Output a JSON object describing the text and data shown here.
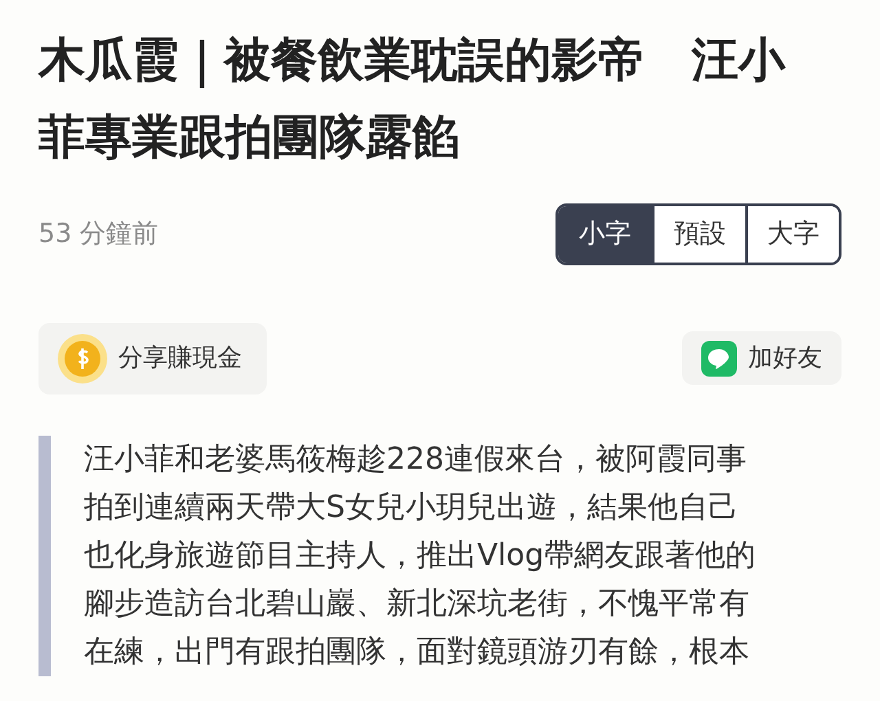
{
  "title": "木瓜霞｜被餐飲業耽誤的影帝　汪小菲專業跟拍團隊露餡",
  "time": "53 分鐘前",
  "font_sizes": [
    {
      "label": "小字",
      "selected": true
    },
    {
      "label": "預設",
      "selected": false
    },
    {
      "label": "大字",
      "selected": false
    }
  ],
  "share_button": "分享賺現金",
  "add_friend_button": "加好友",
  "quote_lines": [
    "汪小菲和老婆馬筱梅趁228連假來台，被阿霞同事",
    "拍到連續兩天帶大S女兒小玥兒出遊，結果他自己",
    "也化身旅遊節目主持人，推出Vlog帶網友跟著他的",
    "腳步造訪台北碧山巖、新北深坑老街，不愧平常有",
    "在練，出門有跟拍團隊，面對鏡頭游刃有餘，根本"
  ]
}
